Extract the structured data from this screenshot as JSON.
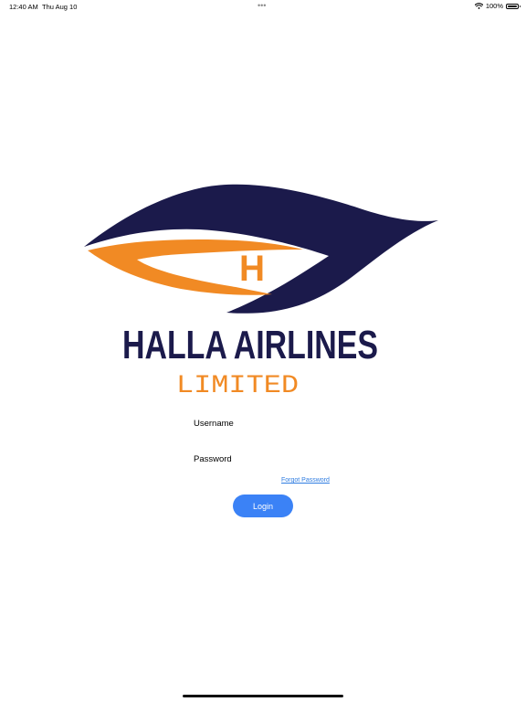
{
  "status_bar": {
    "time": "12:40 AM",
    "date": "Thu Aug 10",
    "dots": "•••",
    "battery": "100%",
    "icons": [
      "wifi-icon",
      "battery-icon"
    ]
  },
  "logo": {
    "brand_line1": "HALLA AIRLINES",
    "brand_line2": "LIMITED",
    "mark_letter": "H",
    "colors": {
      "navy": "#1b1a4b",
      "orange": "#f18a24"
    }
  },
  "login_form": {
    "username_label": "Username",
    "username_value": "",
    "password_label": "Password",
    "password_value": "",
    "forgot_password": "Forgot Password",
    "login_button": "Login",
    "accent_color": "#3b82f6"
  }
}
